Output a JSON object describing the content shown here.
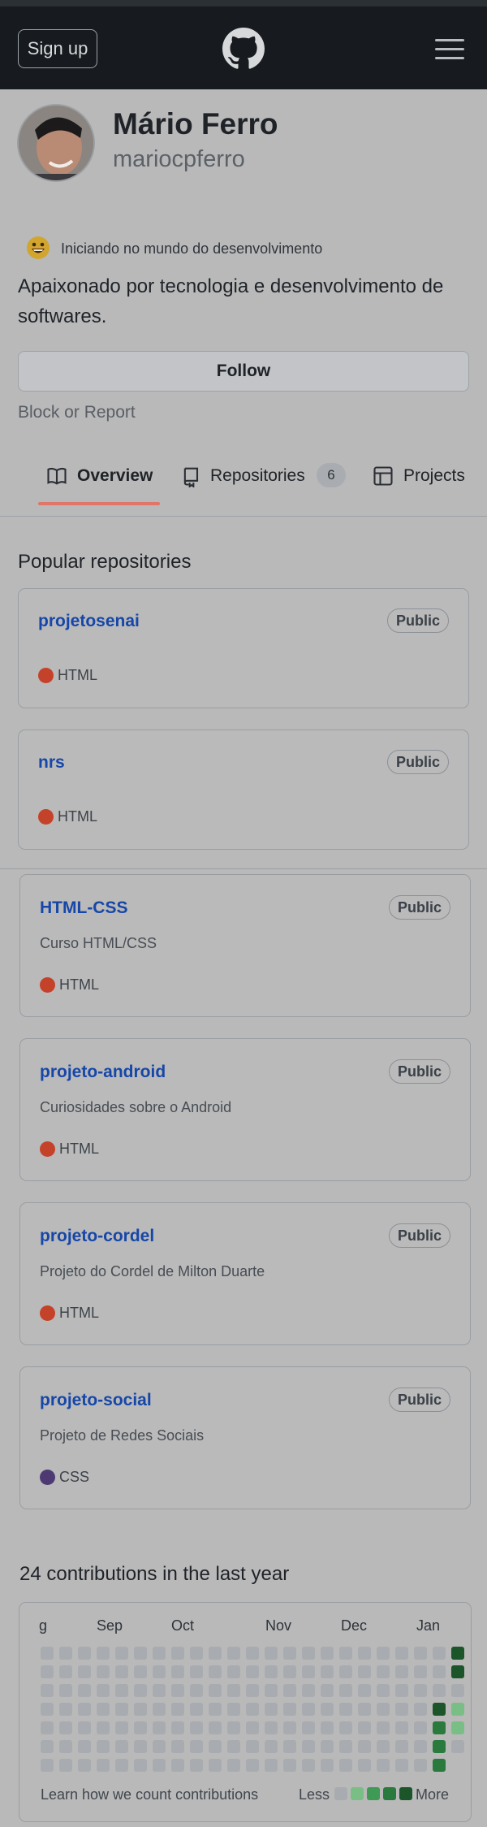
{
  "header": {
    "signup_label": "Sign up",
    "logo_icon": "github-mark-icon",
    "menu_icon": "hamburger-menu-icon"
  },
  "profile": {
    "name": "Mário Ferro",
    "login": "mariocpferro",
    "avatar_icon": "user-avatar",
    "status_emoji": "smiley-icon",
    "status_text": "Iniciando no mundo do desenvolvimento",
    "bio": "Apaixonado por tecnologia e desenvolvimento de softwares.",
    "follow_label": "Follow",
    "block_label": "Block or Report"
  },
  "tabs": [
    {
      "label": "Overview",
      "icon": "book-icon",
      "active": true
    },
    {
      "label": "Repositories",
      "icon": "repo-icon",
      "count": "6"
    },
    {
      "label": "Projects",
      "icon": "table-icon"
    }
  ],
  "popular": {
    "title": "Popular repositories",
    "repos": [
      {
        "name": "projetosenai",
        "visibility": "Public",
        "description": "",
        "language": "HTML",
        "language_color": "#c4422a"
      },
      {
        "name": "nrs",
        "visibility": "Public",
        "description": "",
        "language": "HTML",
        "language_color": "#c4422a"
      },
      {
        "name": "HTML-CSS",
        "visibility": "Public",
        "description": "Curso HTML/CSS",
        "language": "HTML",
        "language_color": "#c4422a"
      },
      {
        "name": "projeto-android",
        "visibility": "Public",
        "description": "Curiosidades sobre o Android",
        "language": "HTML",
        "language_color": "#c4422a"
      },
      {
        "name": "projeto-cordel",
        "visibility": "Public",
        "description": "Projeto do Cordel de Milton Duarte",
        "language": "HTML",
        "language_color": "#c4422a"
      },
      {
        "name": "projeto-social",
        "visibility": "Public",
        "description": "Projeto de Redes Sociais",
        "language": "CSS",
        "language_color": "#4d3a73"
      }
    ]
  },
  "contributions": {
    "title": "24 contributions in the last year",
    "months": [
      "g",
      "Sep",
      "Oct",
      "Nov",
      "Dec",
      "Jan"
    ],
    "learn_label": "Learn how we count contributions",
    "less_label": "Less",
    "more_label": "More",
    "colors": {
      "empty": "#a8acb0",
      "l1": "#79bf85",
      "l2": "#3e9a54",
      "l3": "#2a7a3e",
      "l4": "#1b5529"
    },
    "recent_levels": {
      "col_21": [
        0,
        0,
        0,
        4,
        3,
        3,
        3
      ],
      "col_22": [
        4,
        4,
        0,
        1,
        1,
        0,
        0
      ]
    }
  }
}
